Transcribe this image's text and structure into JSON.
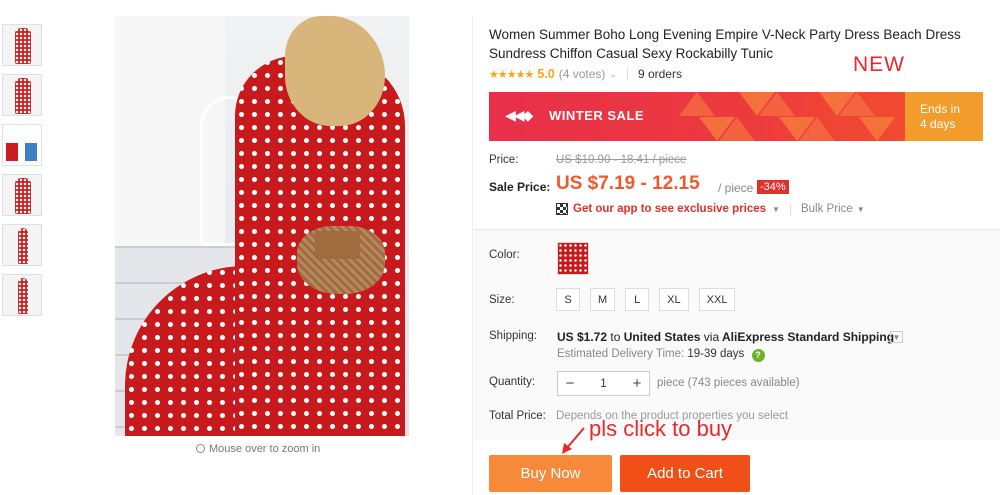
{
  "gallery": {
    "thumbnail_count": 6,
    "zoom_hint": "Mouse over to zoom in"
  },
  "product": {
    "title": "Women Summer Boho Long Evening Empire V-Neck Party Dress Beach Dress Sundress Chiffon Casual Sexy Rockabilly Tunic",
    "stars": "★★★★★",
    "rating": "5.0",
    "votes": "(4 votes)",
    "orders": "9 orders"
  },
  "annotations": {
    "new_tag": "NEW",
    "click_hint": "pls click to buy"
  },
  "banner": {
    "sale_text": "WINTER SALE",
    "ends_label": "Ends in",
    "ends_value": "4 days",
    "background_color": "#ec3a3e",
    "countdown_color": "#f19c2b"
  },
  "pricing": {
    "price_label": "Price:",
    "original_price": "US $10.90 - 18.41 / piece",
    "sale_label": "Sale Price:",
    "sale_price": "US $7.19 - 12.15",
    "unit": "/ piece",
    "discount": "-34%",
    "app_link": "Get our app to see exclusive prices",
    "bulk_price": "Bulk Price",
    "accent_color": "#f05a2a"
  },
  "options": {
    "color_label": "Color:",
    "size_label": "Size:",
    "sizes": [
      "S",
      "M",
      "L",
      "XL",
      "XXL"
    ]
  },
  "shipping": {
    "label": "Shipping:",
    "cost": "US $1.72",
    "to": "to",
    "country": "United States",
    "via": "via",
    "method": "AliExpress Standard Shipping",
    "delivery_label": "Estimated Delivery Time:",
    "delivery_days": "19-39 days",
    "help": "?"
  },
  "quantity": {
    "label": "Quantity:",
    "minus": "−",
    "value": "1",
    "plus": "+",
    "available": "piece (743 pieces available)"
  },
  "total": {
    "label": "Total Price:",
    "text": "Depends on the product properties you select"
  },
  "actions": {
    "buy_now": "Buy Now",
    "add_to_cart": "Add to Cart",
    "buy_color": "#f7893a",
    "cart_color": "#f04f17"
  }
}
